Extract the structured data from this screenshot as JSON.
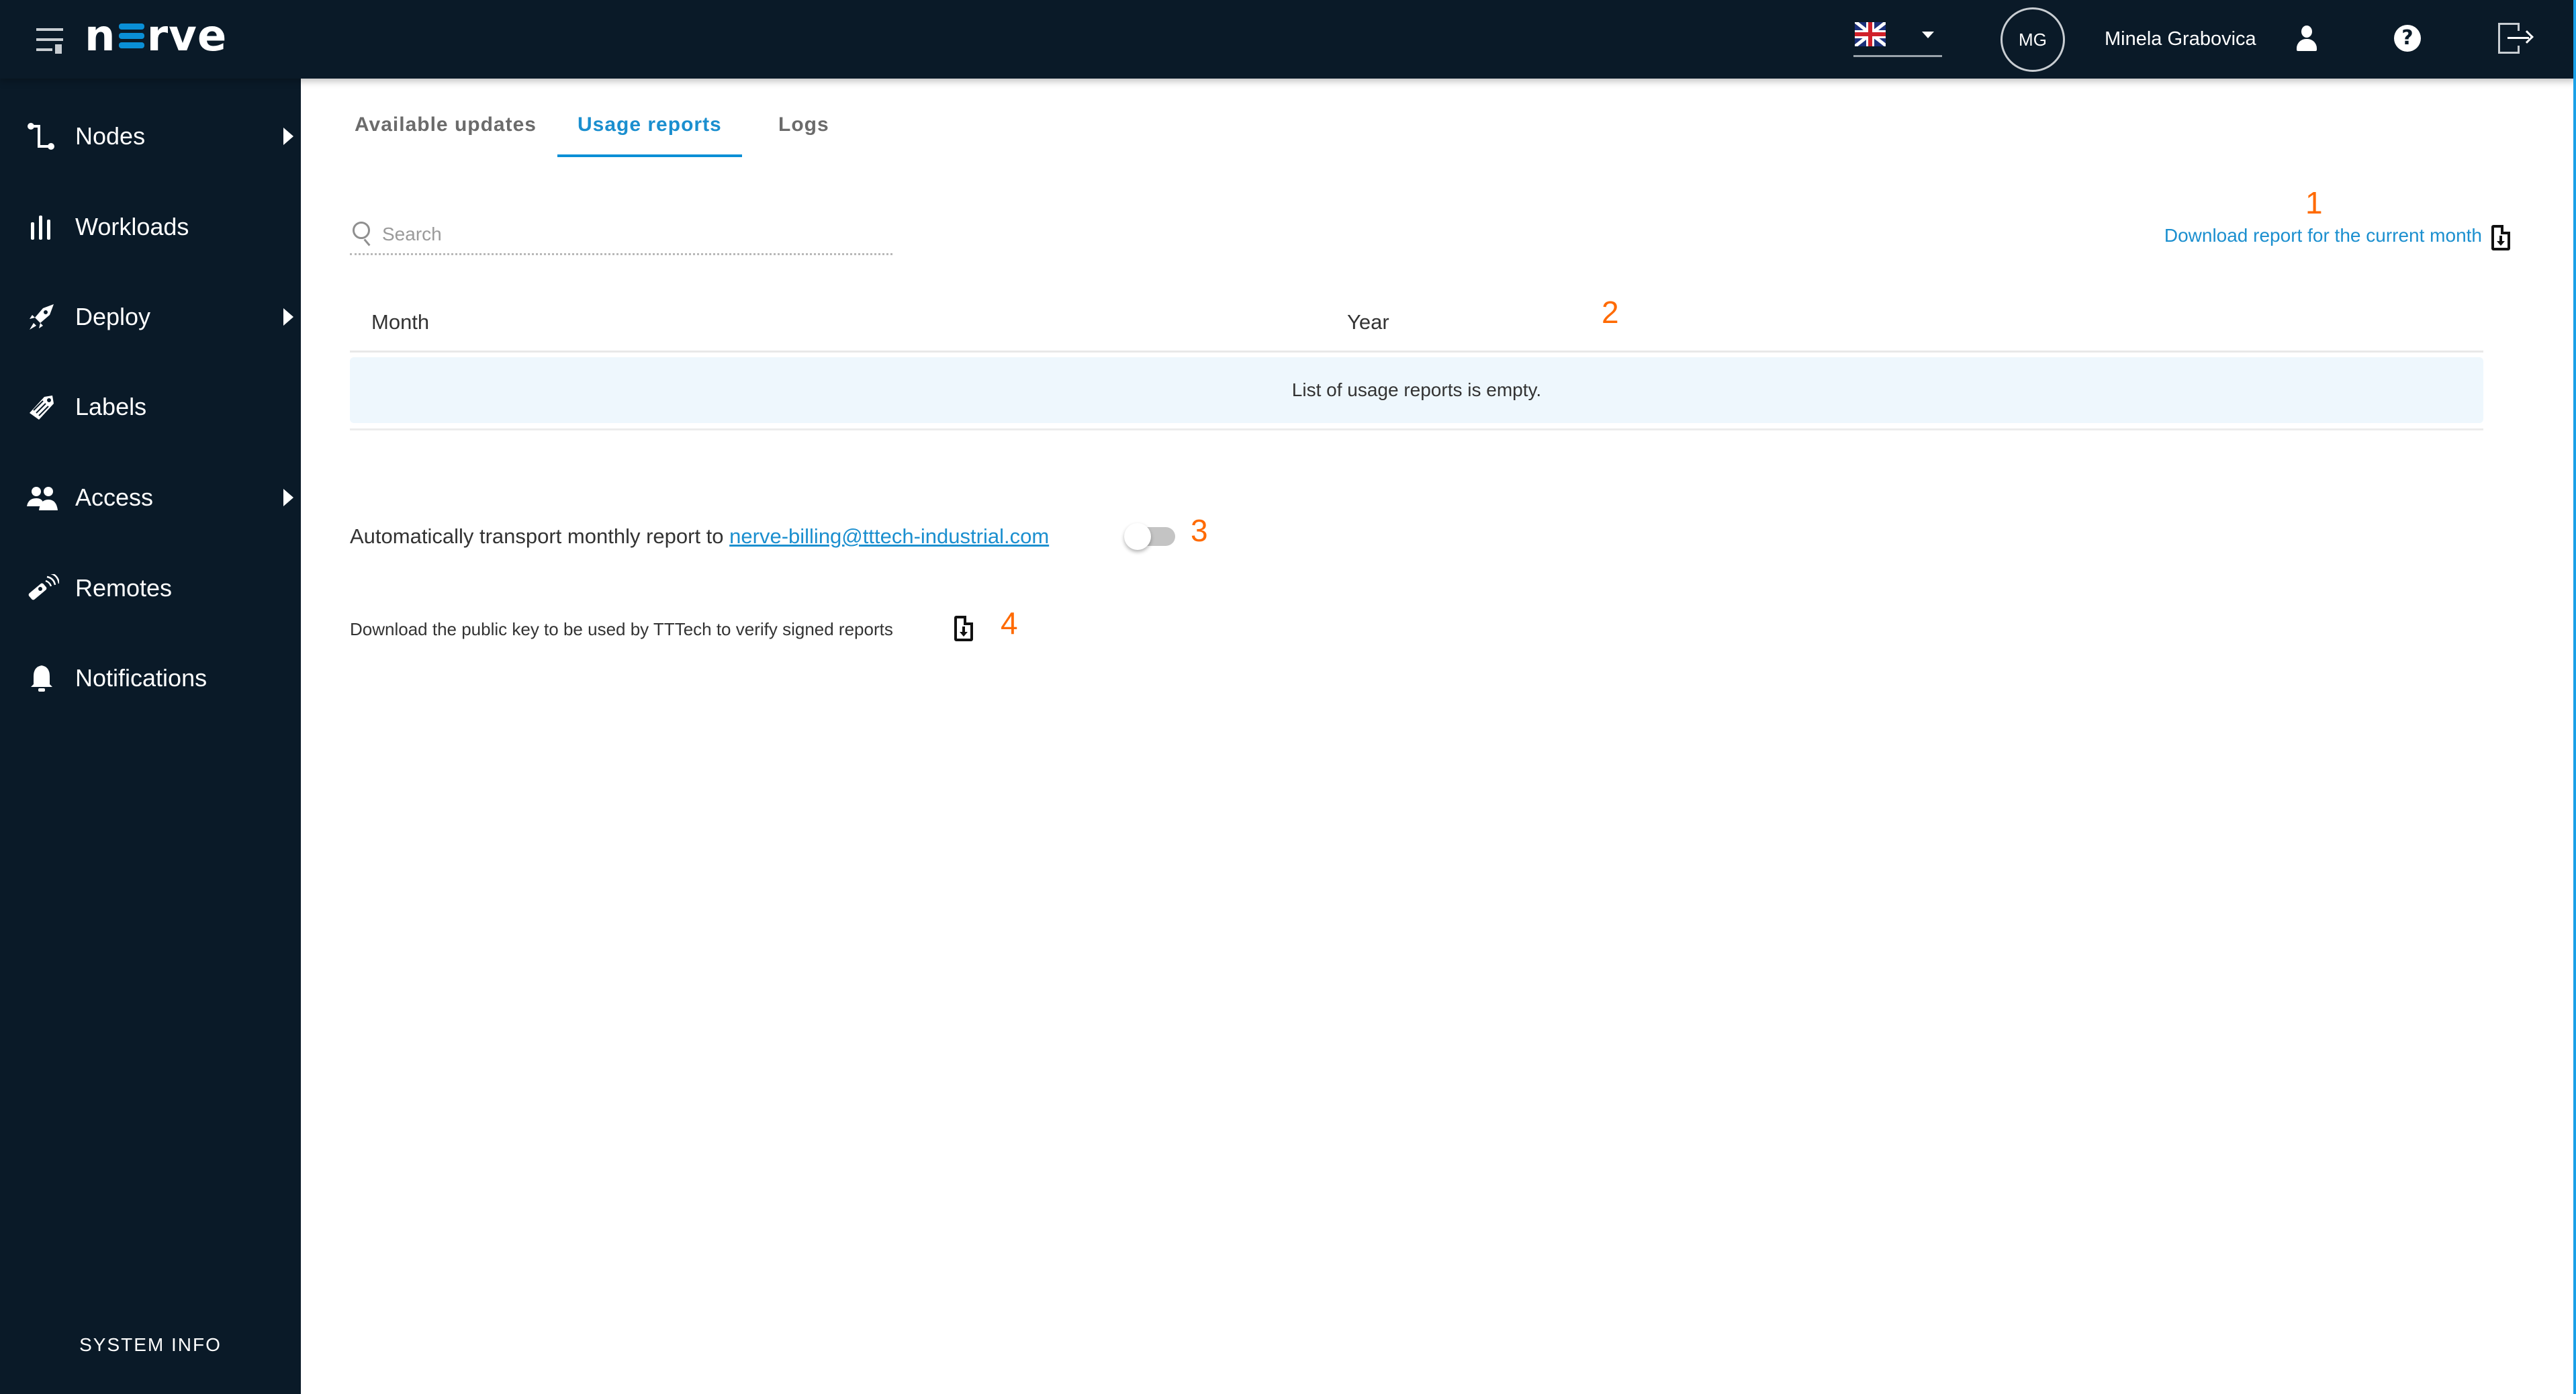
{
  "header": {
    "logo": {
      "prefix": "n",
      "suffix": "rve"
    },
    "language": {
      "selected": "English (UK)",
      "flag": "uk-flag-icon"
    },
    "user": {
      "initials": "MG",
      "name": "Minela Grabovica"
    },
    "icons": [
      "menu-icon",
      "user-icon",
      "help-icon",
      "logout-icon"
    ]
  },
  "sidebar": {
    "items": [
      {
        "label": "Nodes",
        "icon": "nodes-icon",
        "has_submenu": true
      },
      {
        "label": "Workloads",
        "icon": "workloads-icon",
        "has_submenu": false
      },
      {
        "label": "Deploy",
        "icon": "rocket-icon",
        "has_submenu": true
      },
      {
        "label": "Labels",
        "icon": "tag-icon",
        "has_submenu": false
      },
      {
        "label": "Access",
        "icon": "users-icon",
        "has_submenu": true
      },
      {
        "label": "Remotes",
        "icon": "remote-icon",
        "has_submenu": false
      },
      {
        "label": "Notifications",
        "icon": "bell-icon",
        "has_submenu": false
      }
    ],
    "system_info": "SYSTEM INFO"
  },
  "main": {
    "tabs": [
      {
        "label": "Available updates",
        "active": false
      },
      {
        "label": "Usage reports",
        "active": true
      },
      {
        "label": "Logs",
        "active": false
      }
    ],
    "search": {
      "placeholder": "Search",
      "value": ""
    },
    "download_current_month": "Download report for the current month",
    "table": {
      "columns": [
        "Month",
        "Year"
      ],
      "rows": [],
      "empty_message": "List of usage reports is empty."
    },
    "auto_transport": {
      "text": "Automatically transport monthly report to",
      "email": "nerve-billing@tttech-industrial.com",
      "enabled": false
    },
    "public_key": {
      "text": "Download the public key to be used by TTTech to verify signed reports"
    },
    "annotations": [
      "1",
      "2",
      "3",
      "4"
    ]
  },
  "colors": {
    "sidebar_bg": "#0a1a28",
    "accent": "#0a8fd6",
    "link": "#1b8fcf",
    "annotation": "#ff6a00",
    "empty_row_bg": "#eef7fd"
  }
}
